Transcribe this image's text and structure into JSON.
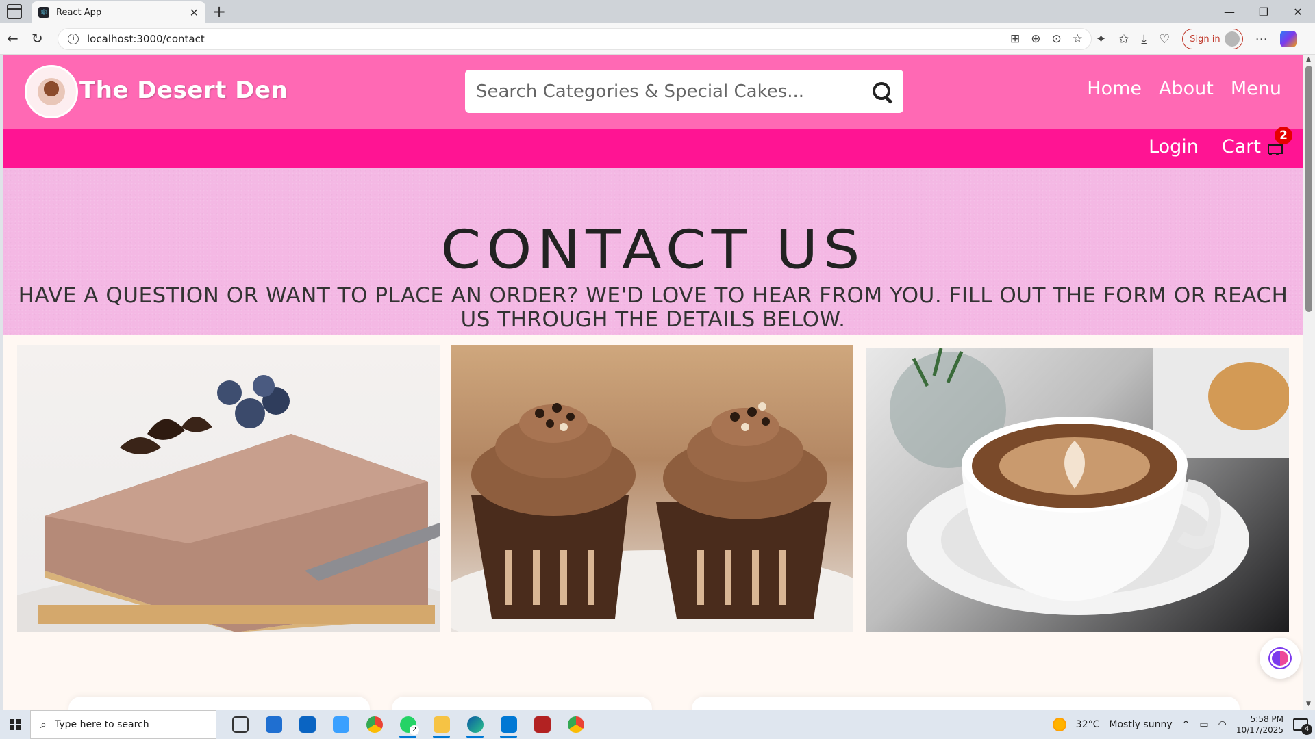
{
  "browser": {
    "tab_title": "React App",
    "url": "localhost:3000/contact",
    "signin_label": "Sign in"
  },
  "site": {
    "brand": "The Desert Den",
    "search_placeholder": "Search Categories & Special Cakes...",
    "nav": [
      "Home",
      "About",
      "Menu"
    ],
    "login_label": "Login",
    "cart_label": "Cart",
    "cart_count": "2"
  },
  "hero": {
    "title": "CONTACT US",
    "subtitle": "Have a question or want to place an order? We'd love to hear from you. Fill out the form or reach us through the details below."
  },
  "photos": [
    {
      "icon": "chocolate-cheesecake-image"
    },
    {
      "icon": "chocolate-cupcakes-image"
    },
    {
      "icon": "latte-coffee-image"
    }
  ],
  "colors": {
    "header_pink": "#ff69b4",
    "subnav_pink": "#ff1493",
    "hero_pink": "#f4b8e4",
    "badge_red": "#e60000"
  },
  "taskbar": {
    "search_placeholder": "Type here to search",
    "whatsapp_badge": "2",
    "weather": "32°C",
    "weather_text": "Mostly sunny",
    "time": "5:58 PM",
    "date": "10/17/2025",
    "notification_count": "4"
  }
}
